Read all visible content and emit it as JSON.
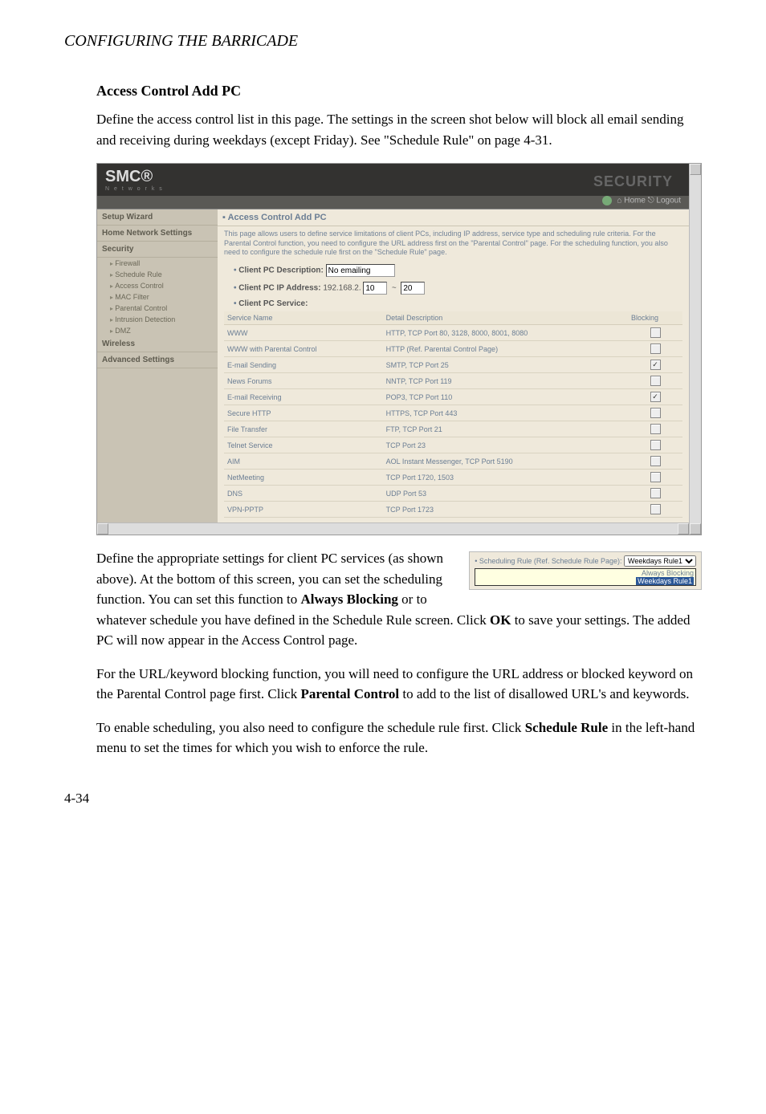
{
  "header": "CONFIGURING THE BARRICADE",
  "section_title": "Access Control Add PC",
  "intro_paragraph": "Define the access control list in this page. The settings in the screen shot below will block all email sending and receiving during weekdays (except Friday). See \"Schedule Rule\" on page 4-31.",
  "screenshot": {
    "logo": "SMC®",
    "logo_sub": "N e t w o r k s",
    "security_label": "SECURITY",
    "home_links": "⌂ Home   ⎋ Logout",
    "sidebar": [
      {
        "label": "Setup Wizard",
        "type": "top"
      },
      {
        "label": "Home Network Settings",
        "type": "top"
      },
      {
        "label": "Security",
        "type": "top"
      },
      {
        "label": "Firewall",
        "type": "sub"
      },
      {
        "label": "Schedule Rule",
        "type": "sub"
      },
      {
        "label": "Access Control",
        "type": "sub"
      },
      {
        "label": "MAC Filter",
        "type": "sub"
      },
      {
        "label": "Parental Control",
        "type": "sub"
      },
      {
        "label": "Intrusion Detection",
        "type": "sub"
      },
      {
        "label": "DMZ",
        "type": "sub"
      },
      {
        "label": "Wireless",
        "type": "top"
      },
      {
        "label": "Advanced Settings",
        "type": "top"
      }
    ],
    "panel_title": "Access Control Add PC",
    "panel_intro": "This page allows users to define service limitations of client PCs, including IP address, service type and scheduling rule criteria. For the Parental Control function, you need to configure the URL address first on the \"Parental Control\" page. For the scheduling function, you also need to configure the schedule rule first on the \"Schedule Rule\" page.",
    "form": {
      "desc_label": "Client PC Description:",
      "desc_value": "No emailing",
      "ip_label": "Client PC IP Address:",
      "ip_prefix": "192.168.2.",
      "ip_from": "10",
      "ip_to": "20",
      "service_label": "Client PC Service:"
    },
    "table": {
      "cols": [
        "Service Name",
        "Detail Description",
        "Blocking"
      ],
      "rows": [
        {
          "svc": "WWW",
          "desc": "HTTP, TCP Port 80, 3128, 8000, 8001, 8080",
          "chk": false
        },
        {
          "svc": "WWW with Parental Control",
          "desc": "HTTP (Ref. Parental Control Page)",
          "chk": false
        },
        {
          "svc": "E-mail Sending",
          "desc": "SMTP, TCP Port 25",
          "chk": true
        },
        {
          "svc": "News Forums",
          "desc": "NNTP, TCP Port 119",
          "chk": false
        },
        {
          "svc": "E-mail Receiving",
          "desc": "POP3, TCP Port 110",
          "chk": true
        },
        {
          "svc": "Secure HTTP",
          "desc": "HTTPS, TCP Port 443",
          "chk": false
        },
        {
          "svc": "File Transfer",
          "desc": "FTP, TCP Port 21",
          "chk": false
        },
        {
          "svc": "Telnet Service",
          "desc": "TCP Port 23",
          "chk": false
        },
        {
          "svc": "AIM",
          "desc": "AOL Instant Messenger, TCP Port 5190",
          "chk": false
        },
        {
          "svc": "NetMeeting",
          "desc": "TCP Port 1720, 1503",
          "chk": false
        },
        {
          "svc": "DNS",
          "desc": "UDP Port 53",
          "chk": false
        },
        {
          "svc": "VPN-PPTP",
          "desc": "TCP Port 1723",
          "chk": false
        }
      ]
    }
  },
  "inset": {
    "label": "• Scheduling Rule (Ref. Schedule Rule Page):",
    "dropdown_value": "Weekdays Rule1",
    "tooltip_line1": "Always Blocking",
    "tooltip_line2": "Weekdays Rule1"
  },
  "paragraphs": {
    "p2a": "Define the appropriate settings for client PC services (as shown above). At the bottom of this screen, you can set the scheduling function. You can set this function to ",
    "p2b": "Always Blocking",
    "p2c": " or to whatever schedule you have defined in the Schedule Rule screen. Click ",
    "p2d": "OK",
    "p2e": " to save your settings. The added PC will now appear in the Access Control page.",
    "p3a": "For the URL/keyword blocking function, you will need to configure the URL address or blocked keyword on the Parental Control page first. Click ",
    "p3b": "Parental Control",
    "p3c": " to add to the list of disallowed URL's and keywords.",
    "p4a": "To enable scheduling, you also need to configure the schedule rule first. Click ",
    "p4b": "Schedule Rule",
    "p4c": " in the left-hand menu to set the times for which you wish to enforce the rule."
  },
  "page_number": "4-34"
}
